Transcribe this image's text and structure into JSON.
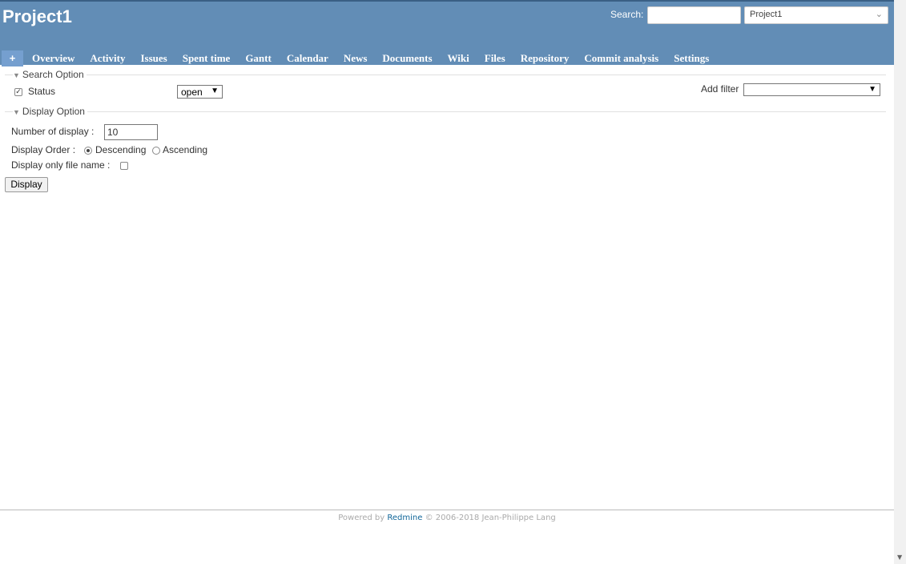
{
  "header": {
    "title": "Project1",
    "search_label": "Search:",
    "search_value": "",
    "project_select": "Project1"
  },
  "menu": {
    "plus": "+",
    "items": [
      "Overview",
      "Activity",
      "Issues",
      "Spent time",
      "Gantt",
      "Calendar",
      "News",
      "Documents",
      "Wiki",
      "Files",
      "Repository",
      "Commit analysis",
      "Settings"
    ]
  },
  "search_option": {
    "legend": "Search Option",
    "status_label": "Status",
    "status_checked": true,
    "status_value": "open",
    "add_filter_label": "Add filter",
    "add_filter_value": ""
  },
  "display_option": {
    "legend": "Display Option",
    "number_label": "Number of display :",
    "number_value": "10",
    "order_label": "Display Order :",
    "order_desc": "Descending",
    "order_asc": "Ascending",
    "order_selected": "Descending",
    "file_only_label": "Display only file name :",
    "file_only_checked": false
  },
  "display_button": "Display",
  "footer": {
    "powered_by": "Powered by",
    "link": "Redmine",
    "copyright": "© 2006-2018 Jean-Philippe Lang"
  },
  "colors": {
    "header_bg": "#628db6",
    "menu_plus_bg": "#759fcf",
    "link": "#116699"
  }
}
